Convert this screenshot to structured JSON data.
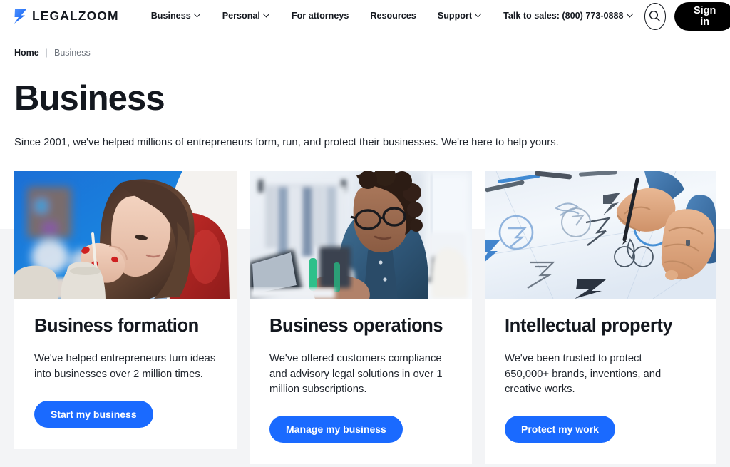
{
  "header": {
    "logo": {
      "icon": "legalzoom-z-icon",
      "text": "LEGALZOOM",
      "accent": "#1a6aff"
    },
    "nav": [
      {
        "label": "Business",
        "has_caret": true
      },
      {
        "label": "Personal",
        "has_caret": true
      },
      {
        "label": "For attorneys",
        "has_caret": false
      },
      {
        "label": "Resources",
        "has_caret": false
      },
      {
        "label": "Support",
        "has_caret": true
      },
      {
        "label": "Talk to sales: (800) 773-0888",
        "has_caret": true
      }
    ],
    "search_icon": "search-icon",
    "signin_label": "Sign in"
  },
  "breadcrumb": {
    "home": "Home",
    "separator": "|",
    "current": "Business"
  },
  "hero": {
    "title": "Business",
    "subtitle": "Since 2001, we've helped millions of entrepreneurs form, run, and protect their businesses. We're here to help yours."
  },
  "cards": [
    {
      "image_alt": "woman-painting-pottery-photo",
      "title": "Business formation",
      "description": "We've helped entrepreneurs turn ideas into businesses over 2 million times.",
      "cta": "Start my business"
    },
    {
      "image_alt": "woman-at-laptop-in-boutique-photo",
      "title": "Business operations",
      "description": "We've offered customers compliance and advisory legal solutions in over 1 million subscriptions.",
      "cta": "Manage my business"
    },
    {
      "image_alt": "hands-sketching-logo-designs-photo",
      "title": "Intellectual property",
      "description": "We've been trusted to protect 650,000+ brands, inventions, and creative works.",
      "cta": "Protect my work"
    }
  ],
  "colors": {
    "brand_blue": "#1a6aff",
    "ink": "#14181f",
    "band_gray": "#f3f4f6",
    "signin_black": "#000000"
  }
}
